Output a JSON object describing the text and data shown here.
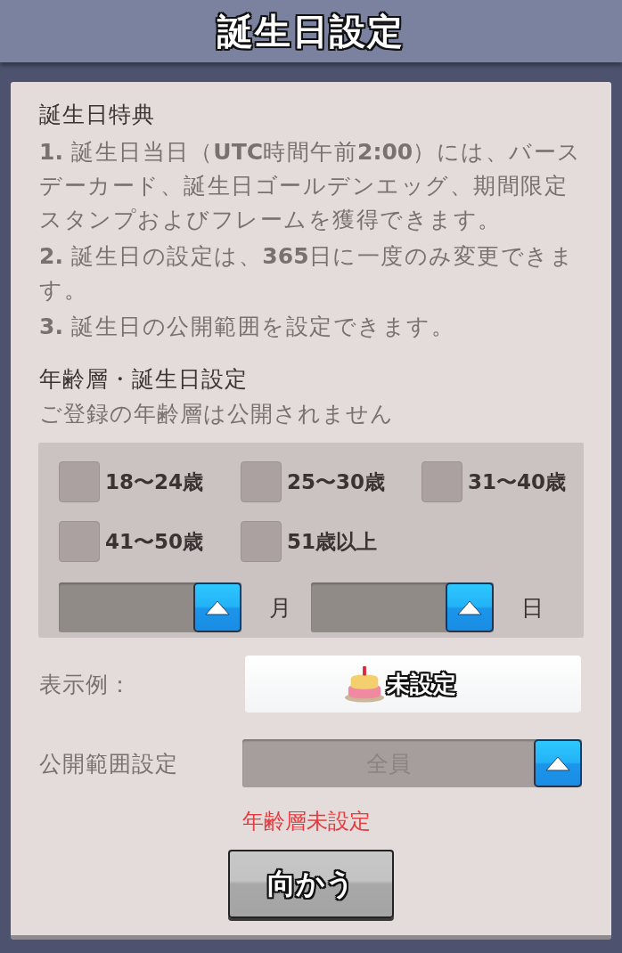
{
  "header": {
    "title": "誕生日設定"
  },
  "benefits": {
    "heading": "誕生日特典",
    "items": [
      "**1.** 誕生日当日（**UTC**時間午前**2:00**）には、バースデーカード、誕生日ゴールデンエッグ、期間限定スタンプおよびフレームを獲得できます。",
      "**2.** 誕生日の設定は、**365**日に一度のみ変更できます。",
      "**3.** 誕生日の公開範囲を設定できます。"
    ]
  },
  "age_birthday": {
    "heading": "年齢層・誕生日設定",
    "note": "ご登録の年齢層は公開されません",
    "age_ranges": [
      {
        "label": "18〜24歳",
        "checked": false
      },
      {
        "label": "25〜30歳",
        "checked": false
      },
      {
        "label": "31〜40歳",
        "checked": false
      },
      {
        "label": "41〜50歳",
        "checked": false
      },
      {
        "label": "51歳以上",
        "checked": false
      }
    ],
    "month": {
      "unit": "月"
    },
    "day": {
      "unit": "日"
    }
  },
  "display_example": {
    "label": "表示例：",
    "value": "未設定"
  },
  "visibility": {
    "label": "公開範囲設定",
    "value": "全員",
    "disabled": true
  },
  "error": "年齢層未設定",
  "button": "向かう"
}
